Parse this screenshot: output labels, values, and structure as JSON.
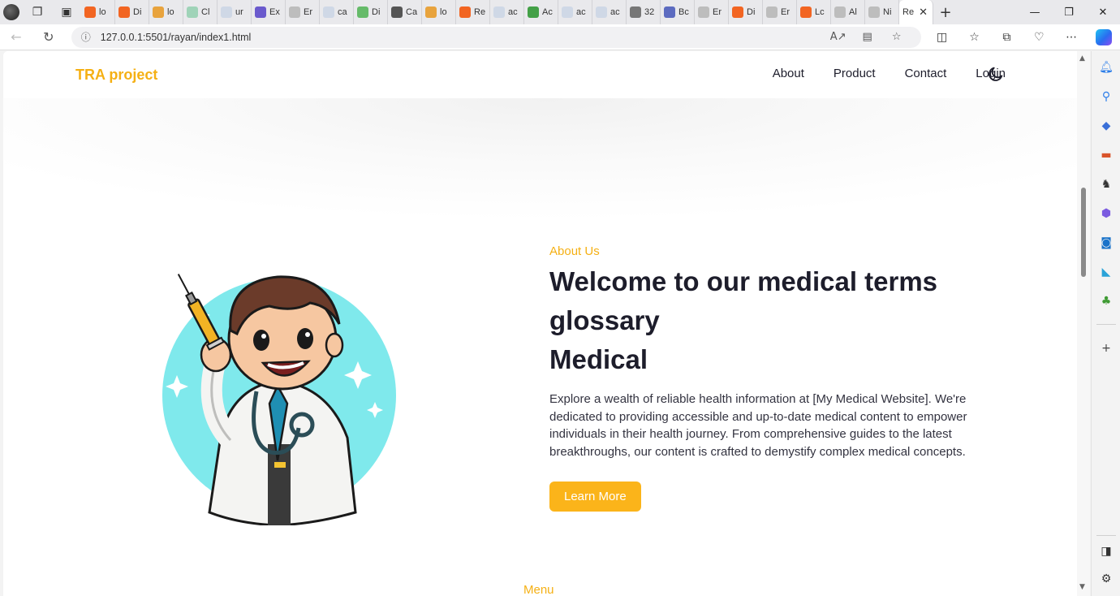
{
  "browser": {
    "tabs": [
      {
        "label": "lo",
        "color": "#f26522"
      },
      {
        "label": "Di",
        "color": "#f26522"
      },
      {
        "label": "lo",
        "color": "#e8a33d"
      },
      {
        "label": "Cl",
        "color": "#9fd3b8"
      },
      {
        "label": "ur",
        "color": "#cfd8e6"
      },
      {
        "label": "Ex",
        "color": "#6a5acd"
      },
      {
        "label": "Er",
        "color": "#bdbdbd"
      },
      {
        "label": "ca",
        "color": "#cfd8e6"
      },
      {
        "label": "Di",
        "color": "#66bb6a"
      },
      {
        "label": "Ca",
        "color": "#555555"
      },
      {
        "label": "lo",
        "color": "#e8a33d"
      },
      {
        "label": "Re",
        "color": "#f26522"
      },
      {
        "label": "ac",
        "color": "#cfd8e6"
      },
      {
        "label": "Ac",
        "color": "#43a047"
      },
      {
        "label": "ac",
        "color": "#cfd8e6"
      },
      {
        "label": "ac",
        "color": "#cfd8e6"
      },
      {
        "label": "32",
        "color": "#777777"
      },
      {
        "label": "Bc",
        "color": "#5c6bc0"
      },
      {
        "label": "Er",
        "color": "#bdbdbd"
      },
      {
        "label": "Di",
        "color": "#f26522"
      },
      {
        "label": "Er",
        "color": "#bdbdbd"
      },
      {
        "label": "Lc",
        "color": "#f26522"
      },
      {
        "label": "Al",
        "color": "#bdbdbd"
      },
      {
        "label": "Ni",
        "color": "#bdbdbd"
      }
    ],
    "active_tab": {
      "label": "Re"
    },
    "address": "127.0.0.1:5501/rayan/index1.html"
  },
  "site": {
    "logo": "TRA project",
    "nav": [
      "About",
      "Product",
      "Contact",
      "Login"
    ],
    "hero": {
      "kicker": "About Us",
      "headline_1": "Welcome to our medical terms",
      "headline_2": "glossary",
      "headline_3": "Medical",
      "description": "Explore a wealth of reliable health information at [My Medical Website]. We're dedicated to providing accessible and up-to-date medical content to empower individuals in their health journey. From comprehensive guides to the latest breakthroughs, our content is crafted to demystify complex medical concepts.",
      "cta": "Learn More"
    },
    "menu_heading": "Menu"
  },
  "colors": {
    "accent": "#f5b014",
    "button": "#fbb41a",
    "illustration_circle": "#7fe9ec"
  },
  "icons": {
    "dark_mode": "moon-icon",
    "sidebar": [
      "bell-icon",
      "search-icon",
      "tag-icon",
      "toolbox-icon",
      "chess-icon",
      "m365-icon",
      "outlook-icon",
      "drop-icon",
      "tree-icon",
      "plus-icon",
      "panel-icon",
      "gear-icon"
    ]
  }
}
